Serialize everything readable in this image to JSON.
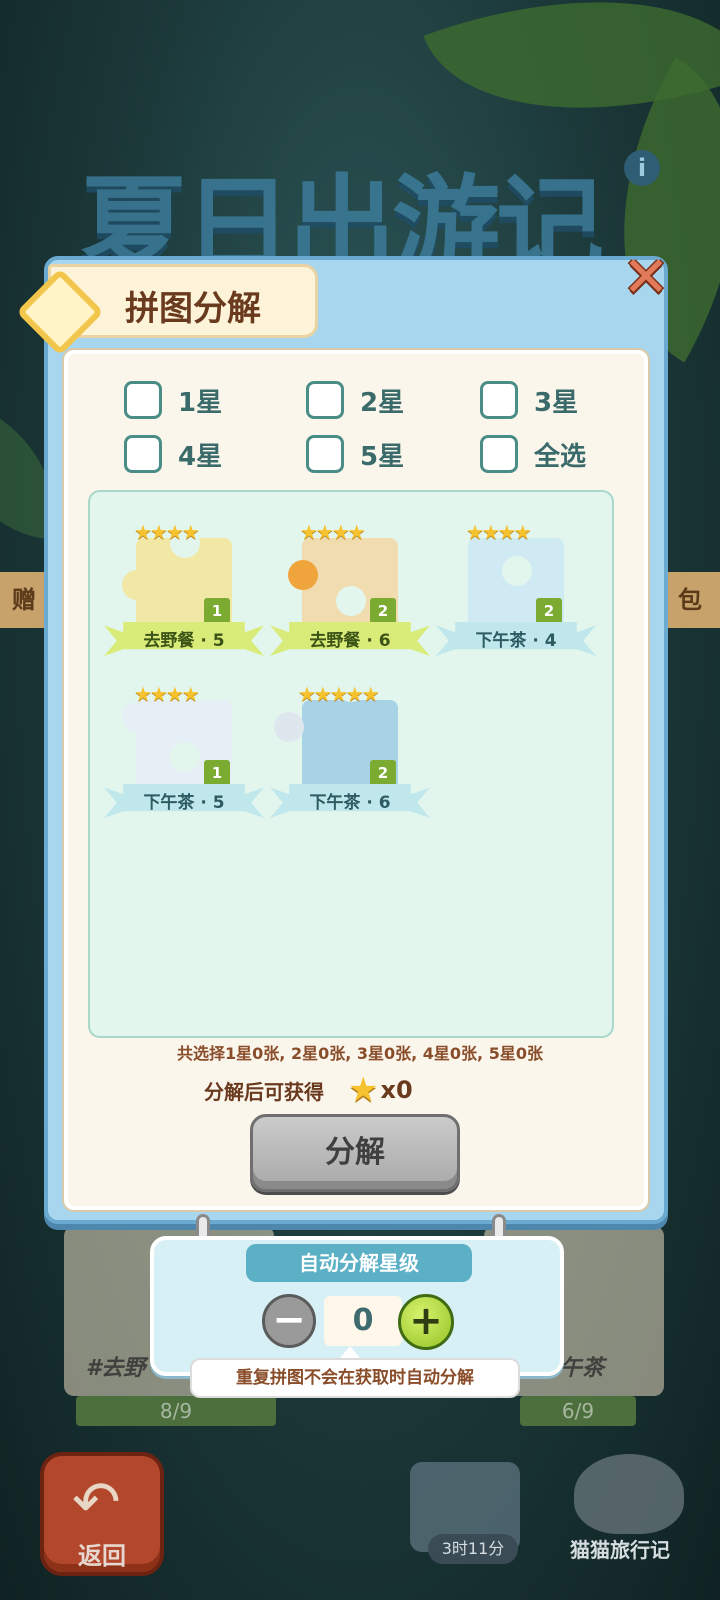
{
  "background": {
    "event_title": "夏日出游记",
    "side_left": "赠",
    "side_right": "包",
    "card_left_label": "#去野",
    "card_right_label": "午茶",
    "progress_left": "8/9",
    "progress_right": "6/9",
    "back_label": "返回",
    "timer_label": "3时11分",
    "cat_label": "猫猫旅行记",
    "info_icon": "i"
  },
  "modal": {
    "title": "拼图分解",
    "close_icon": "close-icon",
    "filters": [
      "1星",
      "2星",
      "3星",
      "4星",
      "5星",
      "全选"
    ],
    "pieces": [
      {
        "stars": "★★★★",
        "count": "1",
        "label": "去野餐 · 5",
        "ribbon_color": "#d9ec7a",
        "img_color": "#f2e8a6"
      },
      {
        "stars": "★★★★",
        "count": "2",
        "label": "去野餐 · 6",
        "ribbon_color": "#d9ec7a",
        "img_color": "#f0dcae"
      },
      {
        "stars": "★★★★",
        "count": "2",
        "label": "下午茶 · 4",
        "ribbon_color": "#bfe7ec",
        "img_color": "#cfeaf3"
      },
      {
        "stars": "★★★★",
        "count": "1",
        "label": "下午茶 · 5",
        "ribbon_color": "#bfe7ec",
        "img_color": "#e6eef6"
      },
      {
        "stars": "★★★★★",
        "count": "2",
        "label": "下午茶 · 6",
        "ribbon_color": "#bfe7ec",
        "img_color": "#a8d3e6"
      }
    ],
    "summary": "共选择1星0张, 2星0张, 3星0张, 4星0张, 5星0张",
    "gain_label": "分解后可获得",
    "gain_value": "x0",
    "decompose_button": "分解"
  },
  "auto_panel": {
    "title": "自动分解星级",
    "minus": "−",
    "value": "0",
    "plus": "+",
    "tooltip": "重复拼图不会在获取时自动分解"
  }
}
